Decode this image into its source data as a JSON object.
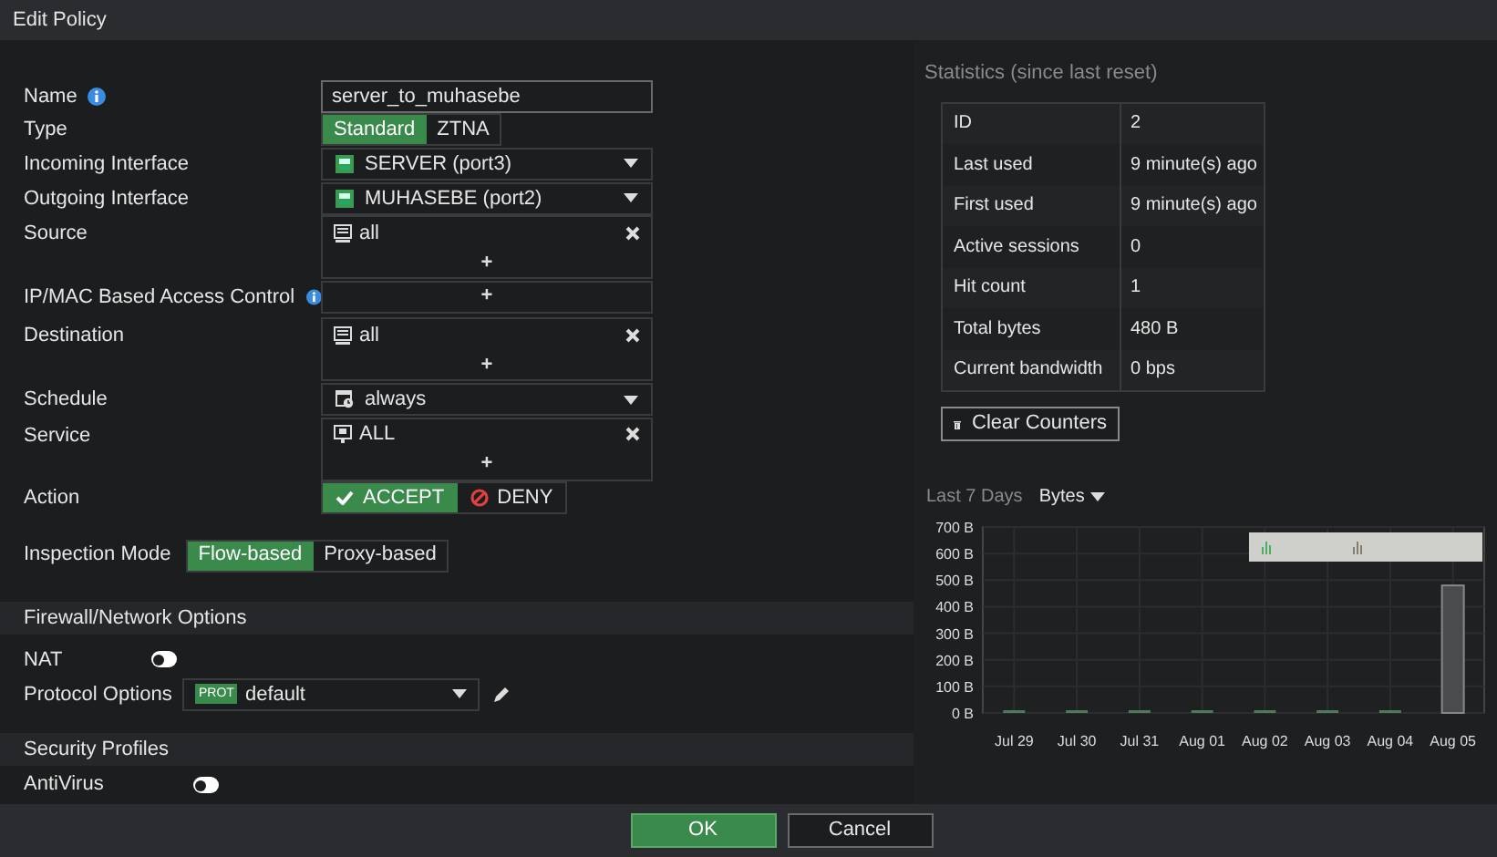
{
  "window": {
    "title": "Edit Policy"
  },
  "form": {
    "name": {
      "label": "Name",
      "value": "server_to_muhasebe"
    },
    "type": {
      "label": "Type",
      "options": [
        {
          "label": "Standard",
          "selected": true
        },
        {
          "label": "ZTNA",
          "selected": false
        }
      ]
    },
    "incoming": {
      "label": "Incoming Interface",
      "value": "SERVER (port3)"
    },
    "outgoing": {
      "label": "Outgoing Interface",
      "value": "MUHASEBE (port2)"
    },
    "source": {
      "label": "Source",
      "value": "all",
      "add": "+"
    },
    "ipmac": {
      "label": "IP/MAC Based Access Control",
      "add": "+"
    },
    "destination": {
      "label": "Destination",
      "value": "all",
      "add": "+"
    },
    "schedule": {
      "label": "Schedule",
      "value": "always"
    },
    "service": {
      "label": "Service",
      "value": "ALL",
      "add": "+"
    },
    "action": {
      "label": "Action",
      "options": [
        {
          "label": "ACCEPT",
          "kind": "accept",
          "selected": true
        },
        {
          "label": "DENY",
          "kind": "deny",
          "selected": false
        }
      ]
    },
    "inspection": {
      "label": "Inspection Mode",
      "options": [
        {
          "label": "Flow-based",
          "selected": true
        },
        {
          "label": "Proxy-based",
          "selected": false
        }
      ]
    }
  },
  "firewall": {
    "title": "Firewall/Network Options",
    "nat": {
      "label": "NAT",
      "on": false
    },
    "protocol": {
      "label": "Protocol Options",
      "tag": "PROT",
      "value": "default"
    }
  },
  "security": {
    "title": "Security Profiles",
    "antivirus": {
      "label": "AntiVirus",
      "on": false
    }
  },
  "statistics": {
    "title": "Statistics (since last reset)",
    "rows": [
      {
        "label": "ID",
        "value": "2"
      },
      {
        "label": "Last used",
        "value": "9 minute(s) ago"
      },
      {
        "label": "First used",
        "value": "9 minute(s) ago"
      },
      {
        "label": "Active sessions",
        "value": "0"
      },
      {
        "label": "Hit count",
        "value": "1"
      },
      {
        "label": "Total bytes",
        "value": "480 B"
      },
      {
        "label": "Current bandwidth",
        "value": "0 bps"
      }
    ],
    "clear_button": "Clear Counters"
  },
  "traffic": {
    "period": "Last 7 Days",
    "metric": "Bytes",
    "chart_data": {
      "type": "bar",
      "grid": true,
      "categories": [
        "Jul 29",
        "Jul 30",
        "Jul 31",
        "Aug 01",
        "Aug 02",
        "Aug 03",
        "Aug 04",
        "Aug 05"
      ],
      "ylim": [
        0,
        700
      ],
      "yticks": [
        {
          "value": 0,
          "label": "0 B"
        },
        {
          "value": 100,
          "label": "100 B"
        },
        {
          "value": 200,
          "label": "200 B"
        },
        {
          "value": 300,
          "label": "300 B"
        },
        {
          "value": 400,
          "label": "400 B"
        },
        {
          "value": 500,
          "label": "500 B"
        },
        {
          "value": 600,
          "label": "600 B"
        },
        {
          "value": 700,
          "label": "700 B"
        }
      ],
      "values": [
        0,
        0,
        0,
        0,
        0,
        0,
        0,
        480
      ]
    }
  },
  "buttons": [
    {
      "label": "OK",
      "kind": "primary"
    },
    {
      "label": "Cancel",
      "kind": "secondary"
    }
  ]
}
